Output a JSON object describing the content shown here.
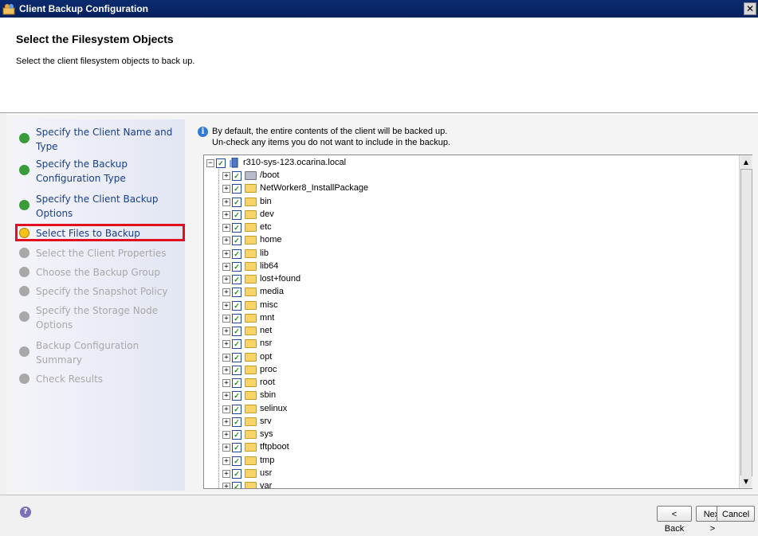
{
  "window": {
    "title": "Client Backup Configuration",
    "close_glyph": "✕"
  },
  "header": {
    "title": "Select the Filesystem Objects",
    "subtitle": "Select the client filesystem objects to back up."
  },
  "steps": [
    {
      "label": "Specify the Client Name and Type",
      "state": "done"
    },
    {
      "label": "Specify the Backup Configuration Type",
      "state": "done"
    },
    {
      "label": "Specify the Client Backup Options",
      "state": "done"
    },
    {
      "label": "Select Files to Backup",
      "state": "current"
    },
    {
      "label": "Select the Client Properties",
      "state": "todo"
    },
    {
      "label": "Choose the Backup Group",
      "state": "todo"
    },
    {
      "label": "Specify the Snapshot Policy",
      "state": "todo"
    },
    {
      "label": "Specify the Storage Node Options",
      "state": "todo"
    },
    {
      "label": "Backup Configuration Summary",
      "state": "todo"
    },
    {
      "label": "Check Results",
      "state": "todo"
    }
  ],
  "info": {
    "line1": "By default, the entire contents of the client will be backed up.",
    "line2": "Un-check any items you do not want to include in the backup."
  },
  "tree": {
    "root": "r310-sys-123.ocarina.local",
    "items": [
      "/boot",
      "NetWorker8_InstallPackage",
      "bin",
      "dev",
      "etc",
      "home",
      "lib",
      "lib64",
      "lost+found",
      "media",
      "misc",
      "mnt",
      "net",
      "nsr",
      "opt",
      "proc",
      "root",
      "sbin",
      "selinux",
      "srv",
      "sys",
      "tftpboot",
      "tmp",
      "usr",
      "var"
    ]
  },
  "footer": {
    "back": "< Back",
    "next": "Next >",
    "cancel": "Cancel",
    "help": "?"
  },
  "colors": {
    "title_bar": "#06215f",
    "done": "#3a9c38",
    "current": "#f3c21a",
    "highlight": "#e01020"
  }
}
